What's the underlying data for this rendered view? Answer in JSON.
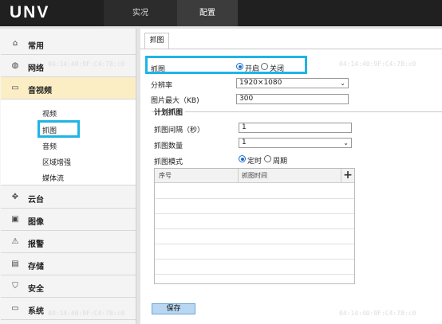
{
  "header": {
    "logo": "UNV",
    "tabs": [
      "实况",
      "配置"
    ]
  },
  "sidebar": {
    "items": [
      {
        "label": "常用",
        "icon": "home-icon"
      },
      {
        "label": "网络",
        "icon": "globe-icon"
      },
      {
        "label": "音视频",
        "icon": "video-icon"
      },
      {
        "label": "云台",
        "icon": "ptz-icon"
      },
      {
        "label": "图像",
        "icon": "image-icon"
      },
      {
        "label": "报警",
        "icon": "alarm-icon"
      },
      {
        "label": "存储",
        "icon": "storage-icon"
      },
      {
        "label": "安全",
        "icon": "shield-icon"
      },
      {
        "label": "系统",
        "icon": "system-icon"
      }
    ],
    "subitems": [
      "视频",
      "抓图",
      "音频",
      "区域增强",
      "媒体流"
    ]
  },
  "page": {
    "tab": "抓图"
  },
  "form": {
    "snapshot_label": "抓图",
    "on_label": "开启",
    "off_label": "关闭",
    "resolution_label": "分辨率",
    "resolution_value": "1920×1080",
    "maxsize_label": "图片最大（KB)",
    "maxsize_value": "300",
    "schedule_title": "计划抓图",
    "interval_label": "抓图间隔（秒）",
    "interval_value": "1",
    "count_label": "抓图数量",
    "count_value": "1",
    "mode_label": "抓图模式",
    "mode_timed": "定时",
    "mode_period": "周期"
  },
  "table": {
    "columns": [
      "序号",
      "抓图时间"
    ],
    "add": "+"
  },
  "save_label": "保存",
  "watermark": "04:14:40:9F:C4:78:c0"
}
